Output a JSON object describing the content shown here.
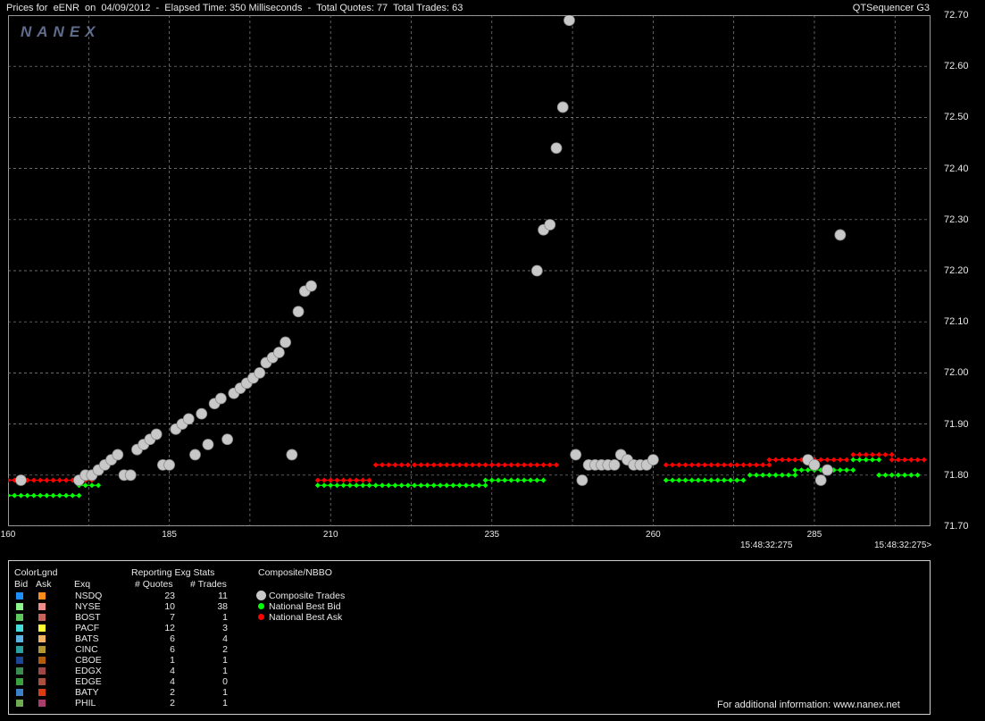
{
  "header": {
    "left": "Prices for  eENR  on  04/09/2012  -  Elapsed Time: 350 Milliseconds  -  Total Quotes: 77  Total Trades: 63",
    "right": "QTSequencer G3"
  },
  "logo": "NANEX",
  "chart_data": {
    "type": "scatter",
    "xlim": [
      160,
      303
    ],
    "ylim": [
      71.7,
      72.7
    ],
    "y_ticks": [
      "72.70",
      "72.60",
      "72.50",
      "72.40",
      "72.30",
      "72.20",
      "72.10",
      "72.00",
      "71.90",
      "71.80",
      "71.70"
    ],
    "x_ticks": [
      "160",
      "185",
      "210",
      "235",
      "260",
      "285"
    ],
    "x_time_labels": [
      "15:48:32:275",
      "15:48:32:275>"
    ],
    "grid": true,
    "colors": {
      "trade": "#c8c8c8",
      "bid": "#00ff00",
      "ask": "#ff0000"
    },
    "series": [
      {
        "name": "Composite Trades",
        "points": [
          [
            162,
            71.79
          ],
          [
            171,
            71.79
          ],
          [
            172,
            71.8
          ],
          [
            173,
            71.8
          ],
          [
            174,
            71.81
          ],
          [
            175,
            71.82
          ],
          [
            176,
            71.83
          ],
          [
            177,
            71.84
          ],
          [
            178,
            71.8
          ],
          [
            179,
            71.8
          ],
          [
            180,
            71.85
          ],
          [
            181,
            71.86
          ],
          [
            182,
            71.87
          ],
          [
            183,
            71.88
          ],
          [
            184,
            71.82
          ],
          [
            185,
            71.82
          ],
          [
            186,
            71.89
          ],
          [
            187,
            71.9
          ],
          [
            188,
            71.91
          ],
          [
            189,
            71.84
          ],
          [
            190,
            71.92
          ],
          [
            191,
            71.86
          ],
          [
            192,
            71.94
          ],
          [
            193,
            71.95
          ],
          [
            194,
            71.87
          ],
          [
            195,
            71.96
          ],
          [
            196,
            71.97
          ],
          [
            197,
            71.98
          ],
          [
            198,
            71.99
          ],
          [
            199,
            72.0
          ],
          [
            200,
            72.02
          ],
          [
            201,
            72.03
          ],
          [
            202,
            72.04
          ],
          [
            203,
            72.06
          ],
          [
            204,
            71.84
          ],
          [
            205,
            72.12
          ],
          [
            206,
            72.16
          ],
          [
            207,
            72.17
          ],
          [
            242,
            72.2
          ],
          [
            243,
            72.28
          ],
          [
            244,
            72.29
          ],
          [
            245,
            72.44
          ],
          [
            246,
            72.52
          ],
          [
            247,
            72.69
          ],
          [
            248,
            71.84
          ],
          [
            249,
            71.79
          ],
          [
            250,
            71.82
          ],
          [
            251,
            71.82
          ],
          [
            252,
            71.82
          ],
          [
            253,
            71.82
          ],
          [
            254,
            71.82
          ],
          [
            255,
            71.84
          ],
          [
            256,
            71.83
          ],
          [
            257,
            71.82
          ],
          [
            258,
            71.82
          ],
          [
            259,
            71.82
          ],
          [
            260,
            71.83
          ],
          [
            284,
            71.83
          ],
          [
            285,
            71.82
          ],
          [
            286,
            71.79
          ],
          [
            287,
            71.81
          ],
          [
            289,
            72.27
          ]
        ]
      },
      {
        "name": "National Best Bid",
        "segments": [
          [
            160,
            171,
            71.76
          ],
          [
            171,
            174,
            71.78
          ],
          [
            208,
            234,
            71.78
          ],
          [
            234,
            243,
            71.79
          ],
          [
            262,
            274,
            71.79
          ],
          [
            275,
            282,
            71.8
          ],
          [
            282,
            287,
            71.81
          ],
          [
            287,
            291,
            71.81
          ],
          [
            291,
            295,
            71.83
          ],
          [
            295,
            301,
            71.8
          ]
        ]
      },
      {
        "name": "National Best Ask",
        "segments": [
          [
            160,
            173,
            71.79
          ],
          [
            208,
            216,
            71.79
          ],
          [
            217,
            222,
            71.82
          ],
          [
            223,
            245,
            71.82
          ],
          [
            262,
            278,
            71.82
          ],
          [
            278,
            290,
            71.83
          ],
          [
            291,
            297,
            71.84
          ],
          [
            297,
            302,
            71.83
          ]
        ]
      }
    ]
  },
  "legend": {
    "color_legend_title": "ColorLgnd",
    "bid_header": "Bid",
    "ask_header": "Ask",
    "exq_header": "Exq",
    "stats_title": "Reporting Exg Stats",
    "quotes_header": "# Quotes",
    "trades_header": "# Trades",
    "composite_title": "Composite/NBBO",
    "composite_items": [
      "Composite Trades",
      "National Best Bid",
      "National Best Ask"
    ],
    "exchanges": [
      {
        "name": "NSDQ",
        "quotes": "23",
        "trades": "11",
        "bid_color": "#1e8fff",
        "ask_color": "#ff8c1a"
      },
      {
        "name": "NYSE",
        "quotes": "10",
        "trades": "38",
        "bid_color": "#8cf58c",
        "ask_color": "#f08c8c"
      },
      {
        "name": "BOST",
        "quotes": "7",
        "trades": "1",
        "bid_color": "#5ec85e",
        "ask_color": "#c8645a"
      },
      {
        "name": "PACF",
        "quotes": "12",
        "trades": "3",
        "bid_color": "#46dcdc",
        "ask_color": "#ffff32"
      },
      {
        "name": "BATS",
        "quotes": "6",
        "trades": "4",
        "bid_color": "#5ab4e6",
        "ask_color": "#f0b464"
      },
      {
        "name": "CINC",
        "quotes": "6",
        "trades": "2",
        "bid_color": "#2aa0a0",
        "ask_color": "#b49632"
      },
      {
        "name": "CBOE",
        "quotes": "1",
        "trades": "1",
        "bid_color": "#1e4696",
        "ask_color": "#b45a0a"
      },
      {
        "name": "EDGX",
        "quotes": "4",
        "trades": "1",
        "bid_color": "#3c8c50",
        "ask_color": "#a04646"
      },
      {
        "name": "EDGE",
        "quotes": "4",
        "trades": "0",
        "bid_color": "#3ca03c",
        "ask_color": "#aa503c"
      },
      {
        "name": "BATY",
        "quotes": "2",
        "trades": "1",
        "bid_color": "#3c82c8",
        "ask_color": "#dc3c14"
      },
      {
        "name": "PHIL",
        "quotes": "2",
        "trades": "1",
        "bid_color": "#6eaa50",
        "ask_color": "#aa3c6e"
      }
    ],
    "footer": "For additional information: www.nanex.net"
  }
}
